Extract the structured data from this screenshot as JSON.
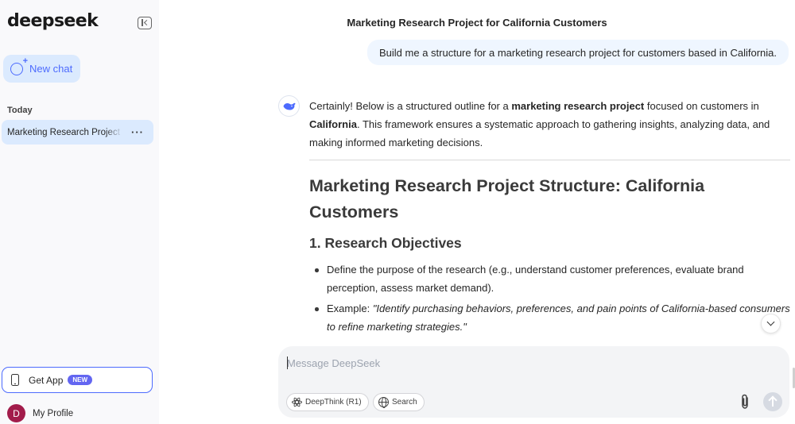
{
  "sidebar": {
    "logo": "deepseek",
    "new_chat_label": "New chat",
    "section_today": "Today",
    "conversations": [
      {
        "title": "Marketing Research Project for California Customers",
        "more": "···"
      }
    ],
    "get_app_label": "Get App",
    "get_app_badge": "NEW",
    "profile_initial": "D",
    "profile_label": "My Profile"
  },
  "main": {
    "chat_title": "Marketing Research Project for California Customers",
    "user_message": "Build me a structure for a marketing research project for customers based in California.",
    "answer": {
      "intro_1": "Certainly! Below is a structured outline for a ",
      "intro_bold_1": "marketing research project",
      "intro_2": " focused on customers in ",
      "intro_bold_2": "California",
      "intro_3": ". This framework ensures a systematic approach to gathering insights, analyzing data, and making informed marketing decisions.",
      "heading": "Marketing Research Project Structure: California Customers",
      "section_1": "1. Research Objectives",
      "bullet_1": "Define the purpose of the research (e.g., understand customer preferences, evaluate brand perception, assess market demand).",
      "bullet_2_prefix": "Example: ",
      "bullet_2_italic": "\"Identify purchasing behaviors, preferences, and pain points of California-based consumers to refine marketing strategies.\""
    },
    "input": {
      "placeholder": "Message DeepSeek",
      "deepthink_label": "DeepThink (R1)",
      "search_label": "Search"
    }
  },
  "colors": {
    "accent": "#4d6bfe",
    "active_bg": "#dbeafe",
    "user_bubble": "#eff6ff",
    "badge": "#6366f1",
    "avatar": "#a21c4b"
  },
  "icons": [
    "collapse-sidebar-icon",
    "new-chat-icon",
    "more-icon",
    "phone-icon",
    "whale-logo-icon",
    "chevron-down-icon",
    "atom-icon",
    "globe-icon",
    "paperclip-icon",
    "arrow-up-icon"
  ]
}
